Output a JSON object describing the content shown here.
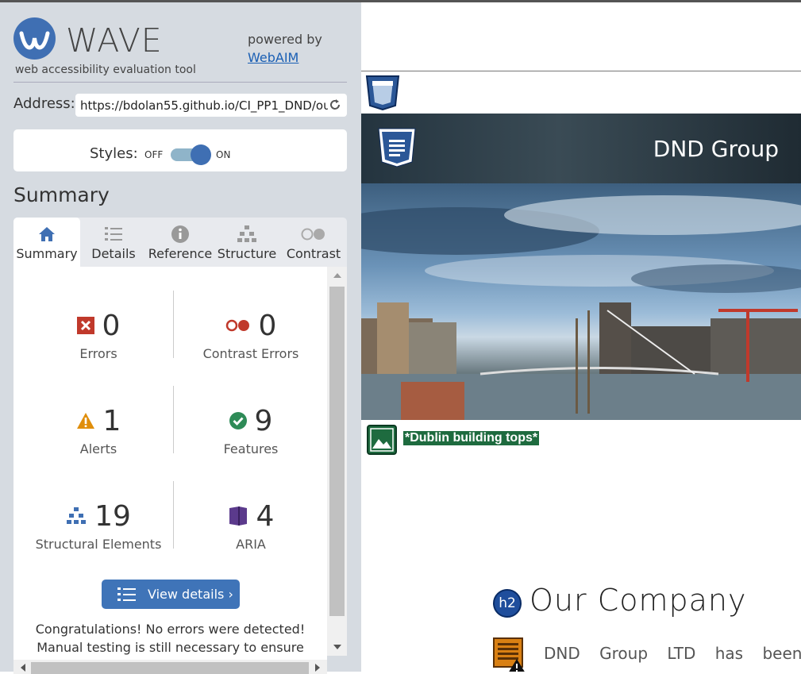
{
  "app": {
    "logo_text": "WAVE",
    "logo_subtitle": "web accessibility evaluation tool",
    "powered_by": "powered by",
    "powered_link": "WebAIM"
  },
  "address": {
    "label": "Address:",
    "value": "https://bdolan55.github.io/CI_PP1_DND/ou"
  },
  "styles": {
    "label": "Styles:",
    "off": "OFF",
    "on": "ON",
    "enabled": true
  },
  "summary": {
    "heading": "Summary",
    "tabs": [
      {
        "label": "Summary",
        "icon": "home-icon",
        "active": true
      },
      {
        "label": "Details",
        "icon": "list-icon",
        "active": false
      },
      {
        "label": "Reference",
        "icon": "info-icon",
        "active": false
      },
      {
        "label": "Structure",
        "icon": "structure-icon",
        "active": false
      },
      {
        "label": "Contrast",
        "icon": "contrast-icon",
        "active": false
      }
    ],
    "stats": [
      {
        "count": "0",
        "label": "Errors",
        "icon": "error-icon"
      },
      {
        "count": "0",
        "label": "Contrast Errors",
        "icon": "contrast-error-icon"
      },
      {
        "count": "1",
        "label": "Alerts",
        "icon": "alert-icon"
      },
      {
        "count": "9",
        "label": "Features",
        "icon": "feature-icon"
      },
      {
        "count": "19",
        "label": "Structural Elements",
        "icon": "structure-icon"
      },
      {
        "count": "4",
        "label": "ARIA",
        "icon": "aria-icon"
      }
    ],
    "view_details": "View details ›",
    "congrats_line1": "Congratulations! No errors were detected!",
    "congrats_line2": "Manual testing is still necessary to ensure"
  },
  "page": {
    "brand": "DND Group",
    "image_alt": "*Dublin building tops*",
    "h2_badge": "h2",
    "section_heading": "Our Company",
    "paragraph": "DND Group LTD has been e"
  },
  "colors": {
    "accent": "#3f74b8",
    "error": "#c0392b",
    "alert": "#e08e0b",
    "feature": "#2e8b57",
    "aria": "#5b3a8c",
    "alt_bg": "#1e6b3f"
  }
}
